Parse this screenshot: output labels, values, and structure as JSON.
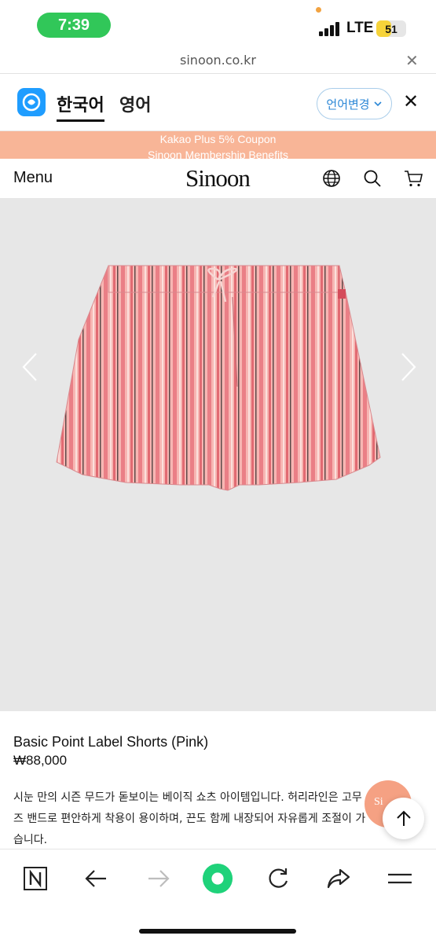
{
  "status": {
    "time": "7:39",
    "network": "LTE",
    "battery": "51",
    "battery_level": 0.51
  },
  "browser": {
    "url": "sinoon.co.kr"
  },
  "translate": {
    "lang_source": "한국어",
    "lang_target": "영어",
    "change_language": "언어변경"
  },
  "promo": {
    "line1": "Kakao Plus 5% Coupon",
    "line2": "Sinoon Membership Benefits"
  },
  "header": {
    "menu": "Menu",
    "logo": "Sinoon"
  },
  "product": {
    "name": "Basic Point Label Shorts (Pink)",
    "price": "₩88,000",
    "description": [
      "시눈 만의 시즌 무드가 돋보이는 베이직 쇼츠 아이템입니다. 허리라인은 고무",
      "즈 밴드로 편안하게 착용이 용이하며, 끈도 함께 내장되어 자유롭게 조절이 가능합",
      "습니다."
    ]
  },
  "float_badge": "Si",
  "colors": {
    "status_pill": "#31c759",
    "promo": "#f8b597",
    "accent_blue": "#2b87d6",
    "reload_green": "#1fd27a",
    "shorts_pink": "#f2a0a3"
  },
  "icons": {
    "globe": "globe-icon",
    "search": "search-icon",
    "cart": "cart-icon",
    "prev": "chevron-left-icon",
    "next": "chevron-right-icon",
    "scroll_top": "arrow-up-icon",
    "toolbar": [
      "naver-n-icon",
      "back-arrow-icon",
      "forward-arrow-icon",
      "green-dot-icon",
      "reload-icon",
      "share-icon",
      "menu-icon"
    ]
  }
}
